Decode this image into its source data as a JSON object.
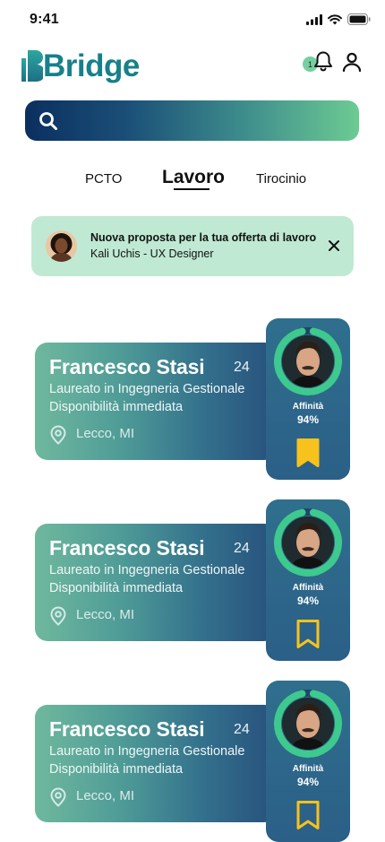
{
  "status_bar": {
    "time": "9:41"
  },
  "app": {
    "logo_text": "Bridge"
  },
  "header": {
    "notification_count": "1"
  },
  "search": {
    "placeholder": ""
  },
  "tabs": [
    {
      "label": "PCTO",
      "active": false
    },
    {
      "label": "Lavoro",
      "active": true
    },
    {
      "label": "Tirocinio",
      "active": false
    }
  ],
  "banner": {
    "title": "Nuova proposta per la tua offerta di lavoro",
    "subtitle": "Kali Uchis - UX Designer"
  },
  "candidates": [
    {
      "name": "Francesco Stasi",
      "age": "24",
      "degree": "Laureato in Ingegneria Gestionale",
      "availability": "Disponibilità immediata",
      "location": "Lecco, MI",
      "affinity_label": "Affinità",
      "affinity": "94%",
      "affinity_fraction": 0.94,
      "bookmarked": true
    },
    {
      "name": "Francesco Stasi",
      "age": "24",
      "degree": "Laureato in Ingegneria Gestionale",
      "availability": "Disponibilità immediata",
      "location": "Lecco, MI",
      "affinity_label": "Affinità",
      "affinity": "94%",
      "affinity_fraction": 0.94,
      "bookmarked": false
    },
    {
      "name": "Francesco Stasi",
      "age": "24",
      "degree": "Laureato in Ingegneria Gestionale",
      "availability": "Disponibilità immediata",
      "location": "Lecco, MI",
      "affinity_label": "Affinità",
      "affinity": "94%",
      "affinity_fraction": 0.94,
      "bookmarked": false
    }
  ],
  "colors": {
    "accent_green": "#3ec98f",
    "bookmark_yellow": "#f7c21b",
    "banner_bg": "#bfe9d3",
    "navy": "#0b2f5f"
  },
  "icons": {
    "search": "search-icon",
    "bell": "bell-icon",
    "user": "user-icon",
    "close": "close-icon",
    "location": "location-pin-icon",
    "bookmark": "bookmark-icon"
  }
}
